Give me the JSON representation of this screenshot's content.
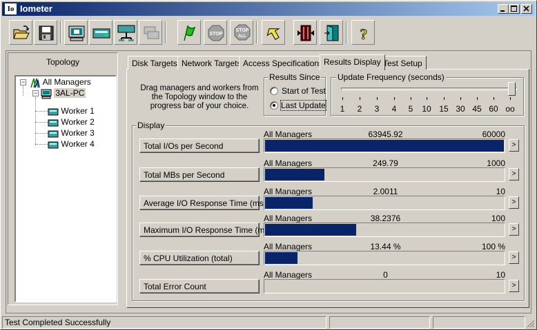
{
  "window": {
    "title": "Iometer",
    "icon_text": "Io"
  },
  "toolbar": {
    "buttons": [
      "open-icon",
      "save-icon",
      "new-disk-worker-icon",
      "new-network-worker-icon",
      "duplicate-worker-icon",
      "disconnect-icon",
      "start-icon",
      "stop-icon",
      "stop-all-icon",
      "reset-workers-icon",
      "exit-icon",
      "help-icon"
    ]
  },
  "topology": {
    "title": "Topology",
    "root": "All Managers",
    "manager": "3AL-PC",
    "workers": [
      "Worker 1",
      "Worker 2",
      "Worker 3",
      "Worker 4"
    ]
  },
  "tabs": [
    "Disk Targets",
    "Network Targets",
    "Access Specifications",
    "Results Display",
    "Test Setup"
  ],
  "results_display": {
    "hint": "Drag managers and workers from the Topology window to the progress bar of your choice.",
    "results_since": {
      "label": "Results Since",
      "options": [
        "Start of Test",
        "Last Update"
      ],
      "selected": "Last Update"
    },
    "update_frequency": {
      "label": "Update Frequency (seconds)",
      "ticks": [
        "1",
        "2",
        "3",
        "4",
        "5",
        "10",
        "15",
        "30",
        "45",
        "60",
        "oo"
      ],
      "selected": "oo"
    },
    "display_label": "Display",
    "rows": [
      {
        "metric": "Total I/Os per Second",
        "source": "All Managers",
        "value": "63945.92",
        "max": "60000",
        "fill": 1.0
      },
      {
        "metric": "Total MBs per Second",
        "source": "All Managers",
        "value": "249.79",
        "max": "1000",
        "fill": 0.2498
      },
      {
        "metric": "Average I/O Response Time (ms)",
        "source": "All Managers",
        "value": "2.0011",
        "max": "10",
        "fill": 0.2001
      },
      {
        "metric": "Maximum I/O Response Time (ms)",
        "source": "All Managers",
        "value": "38.2376",
        "max": "100",
        "fill": 0.3824
      },
      {
        "metric": "% CPU Utilization (total)",
        "source": "All Managers",
        "value": "13.44 %",
        "max": "100 %",
        "fill": 0.1344
      },
      {
        "metric": "Total Error Count",
        "source": "All Managers",
        "value": "0",
        "max": "10",
        "fill": 0
      }
    ],
    "arrow": ">"
  },
  "statusbar": {
    "text": "Test Completed Successfully"
  }
}
